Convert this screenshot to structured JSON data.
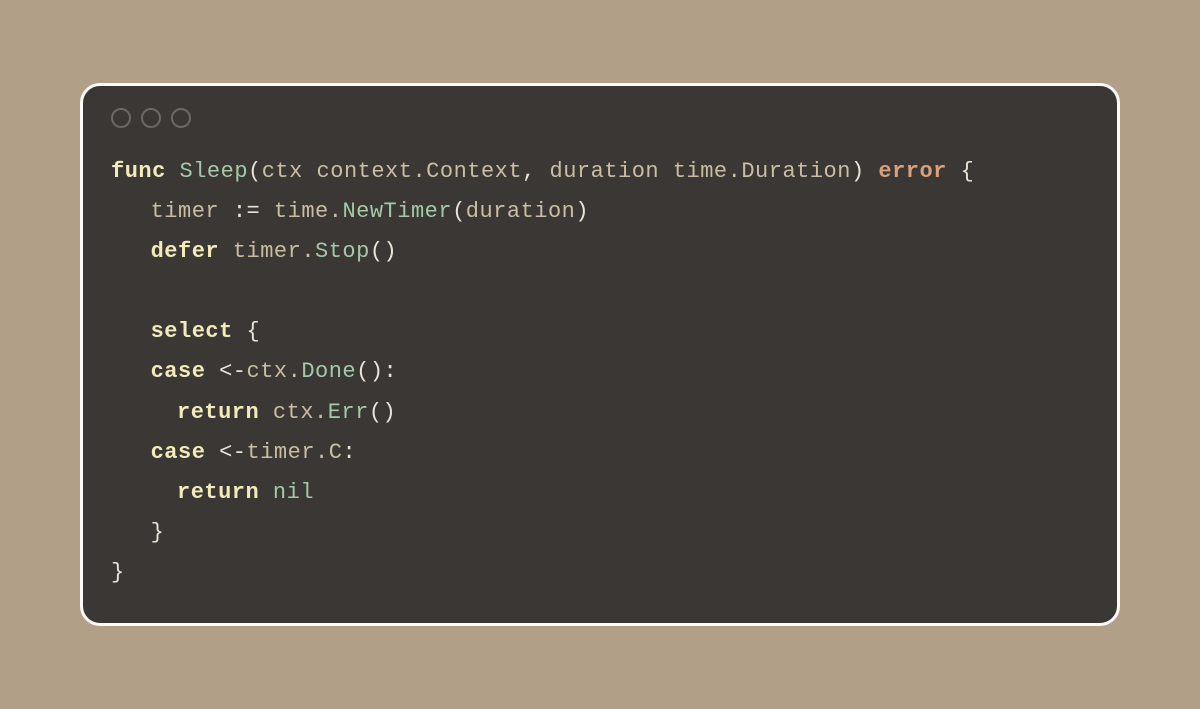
{
  "window": {
    "traffic_lights": 3
  },
  "code": {
    "l1": {
      "kw_func": "func",
      "fn_name": "Sleep",
      "lparen": "(",
      "param1_name": "ctx",
      "param1_type": "context.Context",
      "comma": ", ",
      "param2_name": "duration",
      "param2_type": "time.Duration",
      "rparen": ")",
      "ret_type": "error",
      "lbrace": "{"
    },
    "l2": {
      "var": "timer",
      "assign": ":=",
      "pkg": "time.",
      "call": "NewTimer",
      "lparen": "(",
      "arg": "duration",
      "rparen": ")"
    },
    "l3": {
      "kw_defer": "defer",
      "recv": "timer.",
      "call": "Stop",
      "parens": "()"
    },
    "l4": {
      "blank": ""
    },
    "l5": {
      "kw_select": "select",
      "lbrace": "{"
    },
    "l6": {
      "kw_case": "case",
      "chan_op": "<-",
      "recv": "ctx.",
      "call": "Done",
      "parens": "()",
      "colon": ":"
    },
    "l7": {
      "kw_return": "return",
      "recv": "ctx.",
      "call": "Err",
      "parens": "()"
    },
    "l8": {
      "kw_case": "case",
      "chan_op": "<-",
      "recv": "timer.",
      "field": "C",
      "colon": ":"
    },
    "l9": {
      "kw_return": "return",
      "nil": "nil"
    },
    "l10": {
      "rbrace": "}"
    },
    "l11": {
      "rbrace": "}"
    }
  }
}
